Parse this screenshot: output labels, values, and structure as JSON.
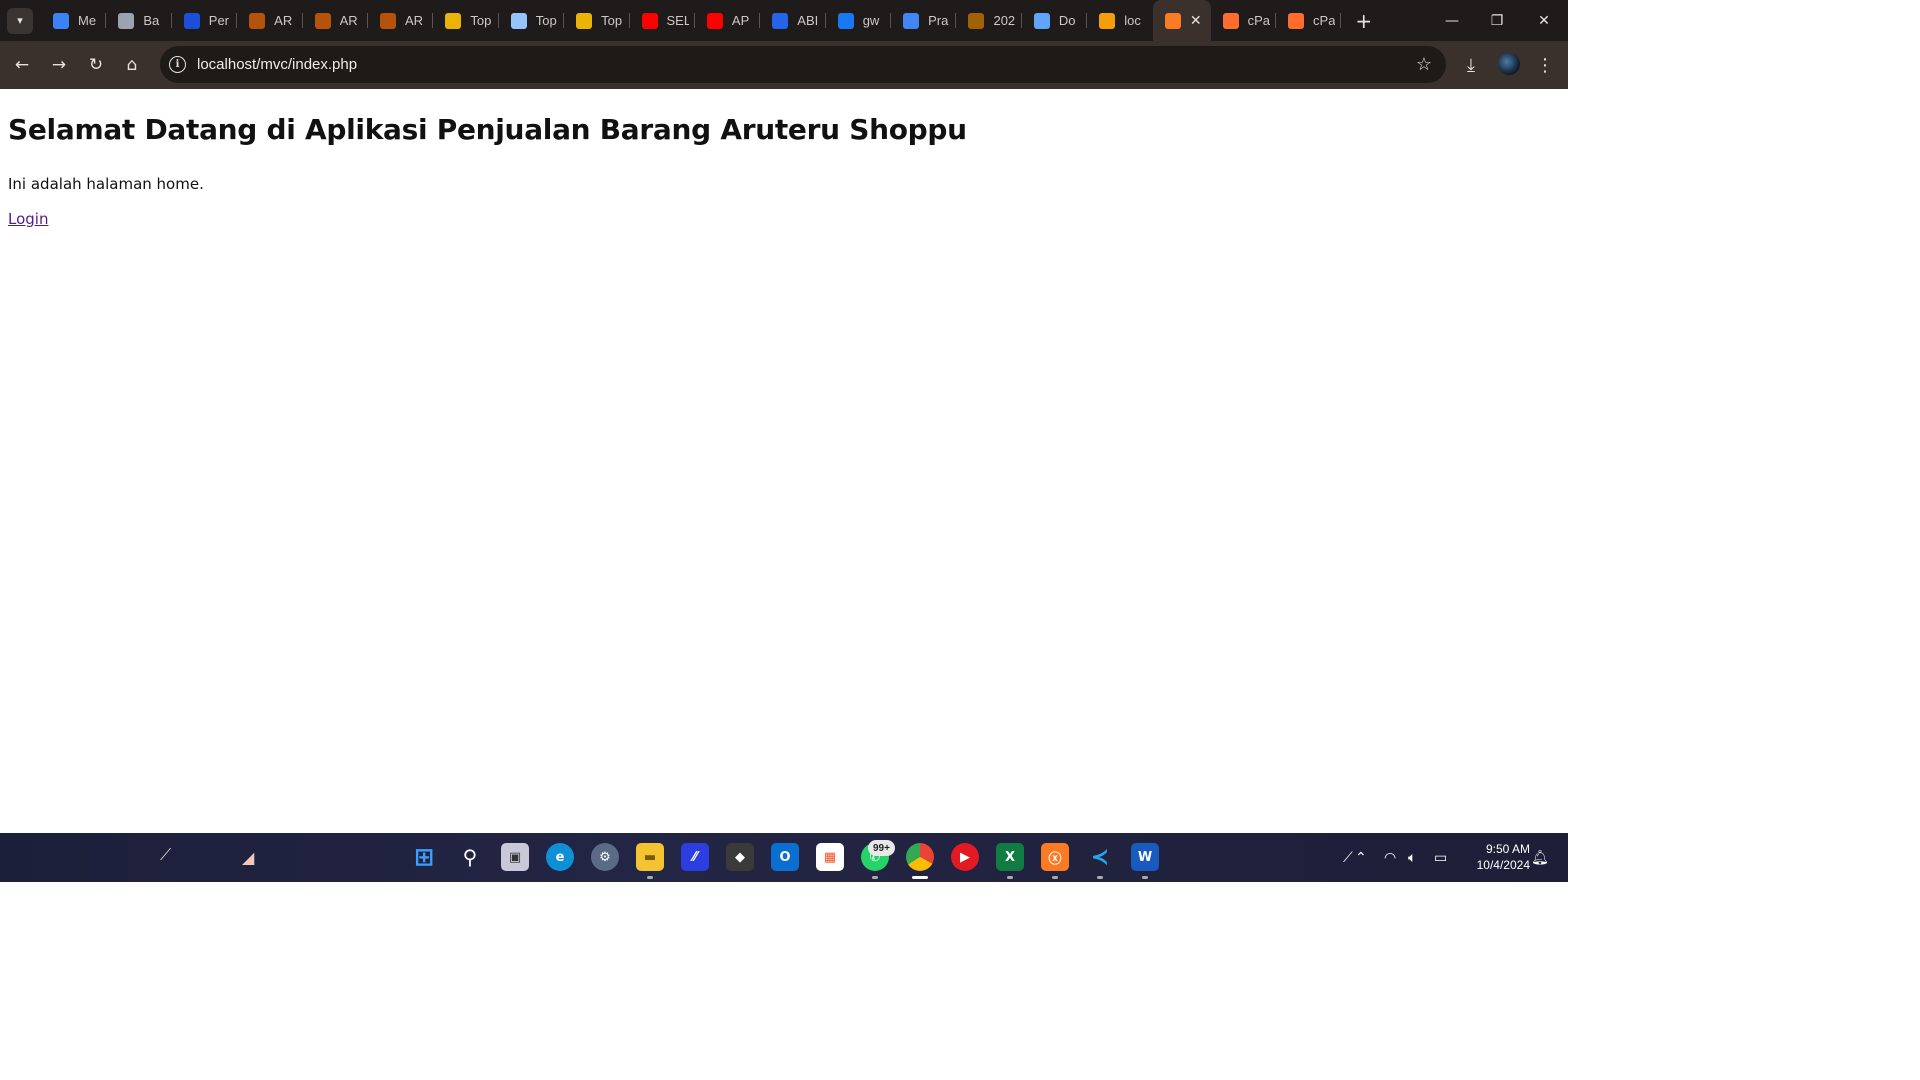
{
  "browser": {
    "tabs": [
      {
        "title": "Me",
        "icon": "s-logo-icon",
        "color": "#3b82f6"
      },
      {
        "title": "Ba",
        "icon": "globe-icon",
        "color": "#9ca3af"
      },
      {
        "title": "Per",
        "icon": "shield-logo-icon",
        "color": "#1d4ed8"
      },
      {
        "title": "AR",
        "icon": "crest-icon",
        "color": "#b45309"
      },
      {
        "title": "AR",
        "icon": "crest-icon",
        "color": "#b45309"
      },
      {
        "title": "AR",
        "icon": "crest-icon",
        "color": "#b45309"
      },
      {
        "title": "Top",
        "icon": "pen-icon",
        "color": "#eab308"
      },
      {
        "title": "Top",
        "icon": "x-logo-icon",
        "color": "#93c5fd"
      },
      {
        "title": "Top",
        "icon": "pen-icon",
        "color": "#eab308"
      },
      {
        "title": "SEL",
        "icon": "youtube-icon",
        "color": "#ff0000"
      },
      {
        "title": "AP",
        "icon": "youtube-icon",
        "color": "#ff0000"
      },
      {
        "title": "ABI",
        "icon": "c-logo-icon",
        "color": "#2563eb"
      },
      {
        "title": "gw",
        "icon": "facebook-icon",
        "color": "#1877f2"
      },
      {
        "title": "Pra",
        "icon": "docs-icon",
        "color": "#4285f4"
      },
      {
        "title": "202",
        "icon": "emblem-icon",
        "color": "#a16207"
      },
      {
        "title": "Do",
        "icon": "network-icon",
        "color": "#60a5fa"
      },
      {
        "title": "loc",
        "icon": "phpmyadmin-icon",
        "color": "#f59e0b"
      },
      {
        "title": "",
        "icon": "xampp-icon",
        "color": "#fb7a24",
        "active": true
      },
      {
        "title": "cPa",
        "icon": "cpanel-icon",
        "color": "#ff6c2c"
      },
      {
        "title": "cPa",
        "icon": "cpanel-icon",
        "color": "#ff6c2c"
      }
    ],
    "url": "localhost/mvc/index.php"
  },
  "page": {
    "heading": "Selamat Datang di Aplikasi Penjualan Barang Aruteru Shoppu",
    "intro": "Ini adalah halaman home.",
    "login_link": "Login",
    "link_color": "#551a8b"
  },
  "taskbar": {
    "notification_badge": "99+",
    "time": "9:50 AM",
    "date": "10/4/2024"
  }
}
